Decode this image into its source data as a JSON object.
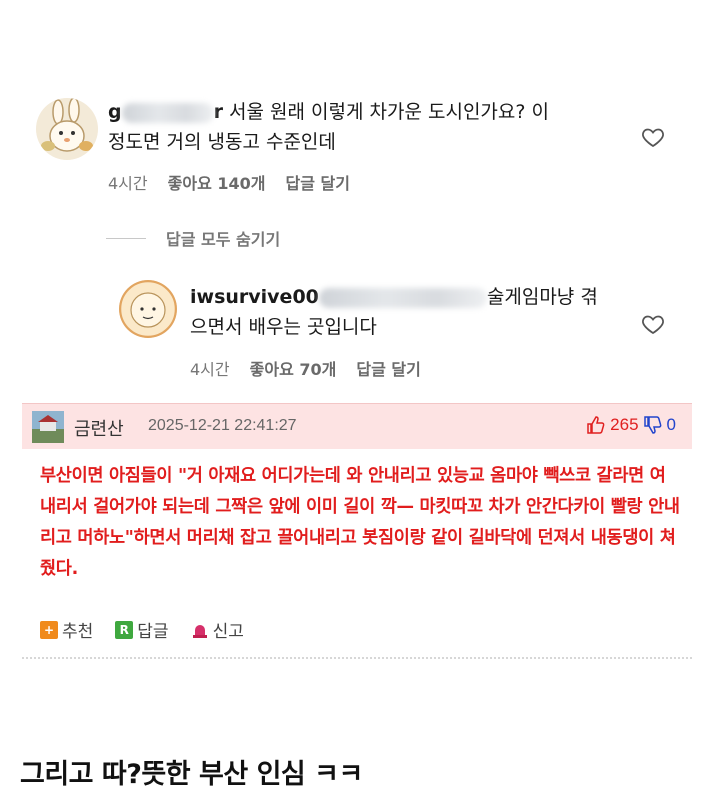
{
  "comment": {
    "username_visible_start": "g",
    "username_visible_end": "r",
    "text_line1": "서울 원래 이렇게 차가운 도시인가요? 이",
    "text_line2": "정도면 거의 냉동고 수준인데",
    "time": "4시간",
    "likes": "좋아요 140개",
    "reply": "답글 달기"
  },
  "hide_replies": "답글 모두 숨기기",
  "reply_comment": {
    "username": "iwsurvive00",
    "text_line1_end": "술게임마냥 겪",
    "text_line2": "으면서 배우는 곳입니다",
    "time": "4시간",
    "likes": "좋아요 70개",
    "reply": "답글 달기"
  },
  "board_comment": {
    "author": "금련산",
    "datetime": "2025-12-21 22:41:27",
    "upvotes": "265",
    "downvotes": "0",
    "body": "부산이면 아짐들이 \"거 아재요 어디가는데 와 안내리고 있능교 옴마야 빽쓰코 갈라면 여 내리서 걸어가야 되는데 그짝은 앞에 이미 길이 깍— 마킷따꼬 차가 안간다카이 빨랑 안내리고 머하노\"하면서 머리채 잡고 끌어내리고 봇짐이랑 같이 길바닥에 던져서 내동댕이 쳐줬다.",
    "actions": {
      "recommend": "추천",
      "reply": "답글",
      "report": "신고"
    }
  },
  "caption": "그리고 따?뜻한 부산 인심 ㅋㅋ",
  "colors": {
    "board_header_bg": "#fde3e3",
    "body_text": "#e11d1d",
    "upvote": "#e02020",
    "downvote": "#2244cc"
  }
}
